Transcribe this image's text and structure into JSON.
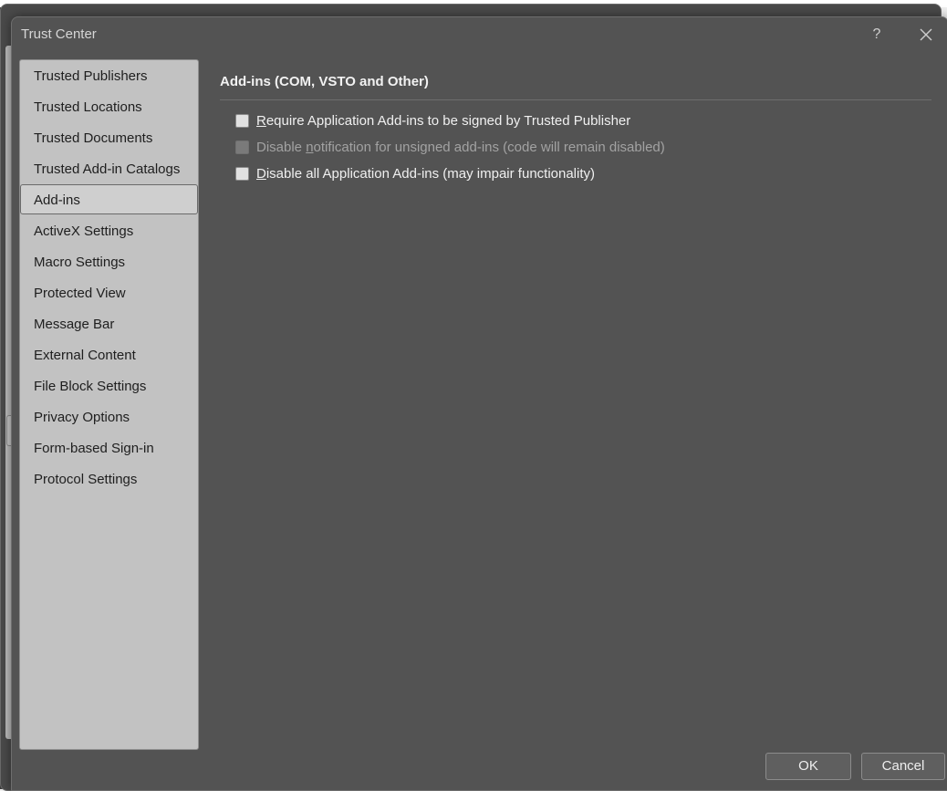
{
  "dialog": {
    "title": "Trust Center",
    "help_label": "?"
  },
  "sidebar": {
    "items": [
      {
        "label": "Trusted Publishers"
      },
      {
        "label": "Trusted Locations"
      },
      {
        "label": "Trusted Documents"
      },
      {
        "label": "Trusted Add-in Catalogs"
      },
      {
        "label": "Add-ins",
        "selected": true
      },
      {
        "label": "ActiveX Settings"
      },
      {
        "label": "Macro Settings"
      },
      {
        "label": "Protected View"
      },
      {
        "label": "Message Bar"
      },
      {
        "label": "External Content"
      },
      {
        "label": "File Block Settings"
      },
      {
        "label": "Privacy Options"
      },
      {
        "label": "Form-based Sign-in"
      },
      {
        "label": "Protocol Settings"
      }
    ]
  },
  "content": {
    "section_title": "Add-ins (COM, VSTO and Other)",
    "options": [
      {
        "access_key": "R",
        "rest": "equire Application Add-ins to be signed by Trusted Publisher",
        "checked": false,
        "enabled": true
      },
      {
        "pre": "Disable ",
        "access_key": "n",
        "rest": "otification for unsigned add-ins (code will remain disabled)",
        "checked": false,
        "enabled": false
      },
      {
        "access_key": "D",
        "rest": "isable all Application Add-ins (may impair functionality)",
        "checked": false,
        "enabled": true
      }
    ]
  },
  "footer": {
    "ok_label": "OK",
    "cancel_label": "Cancel"
  }
}
